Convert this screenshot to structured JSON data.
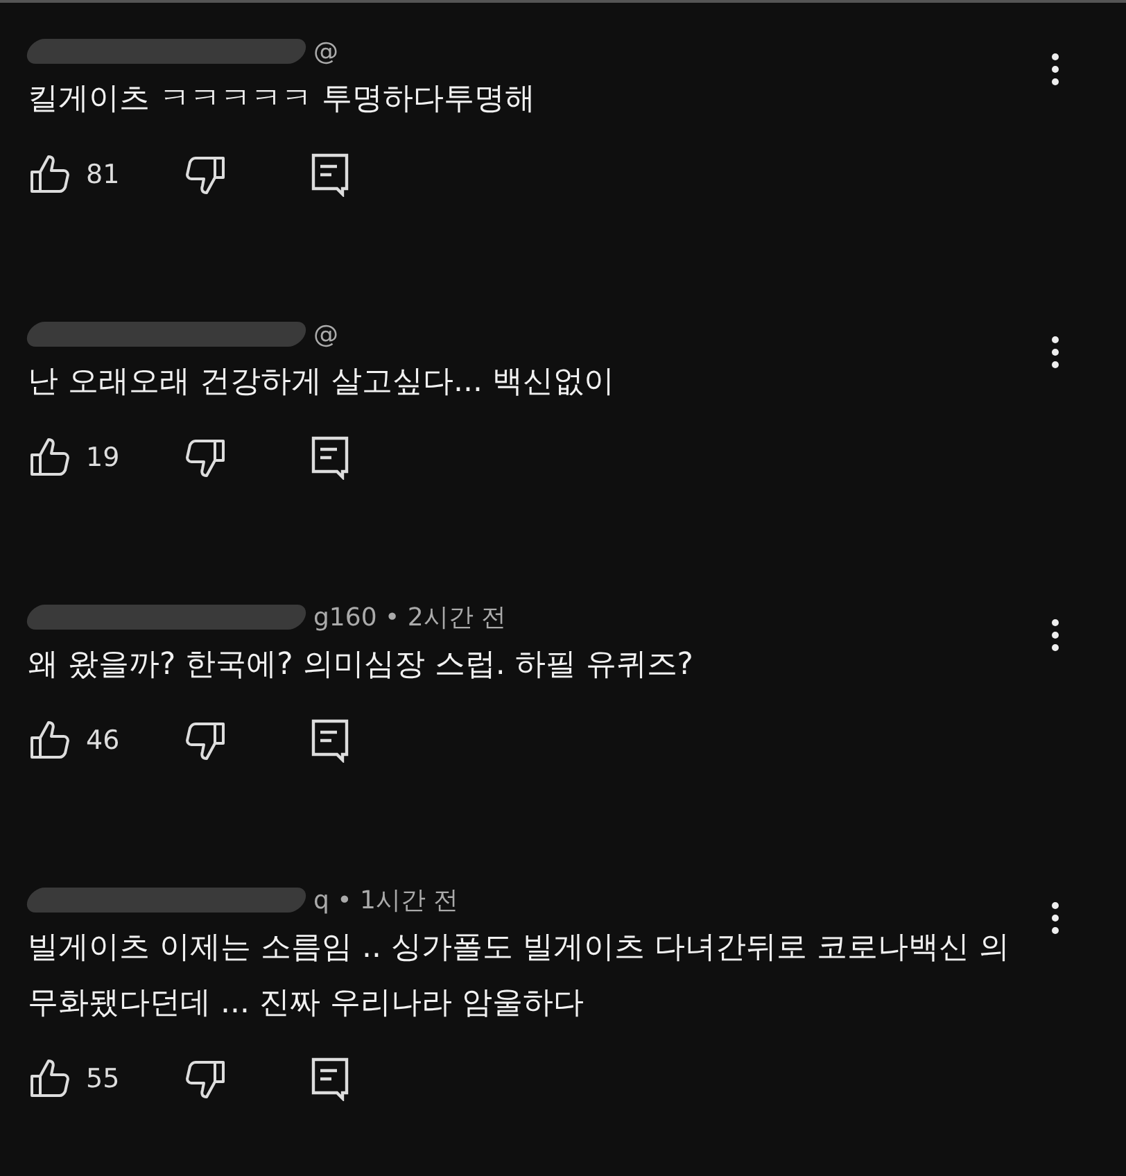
{
  "comments": [
    {
      "author_visible": "@",
      "body": "킬게이츠 ㅋㅋㅋㅋㅋ 투명하다투명해",
      "likes": "81"
    },
    {
      "author_visible": "@",
      "body": "난 오래오래 건강하게 살고싶다...  백신없이",
      "likes": "19"
    },
    {
      "author_visible": "g160 • 2시간 전",
      "body": "왜 왔을까? 한국에? 의미심장 스럽. 하필 유퀴즈?",
      "likes": "46"
    },
    {
      "author_visible": "q • 1시간 전",
      "body": "빌게이츠 이제는 소름임 .. 싱가폴도 빌게이츠 다녀간뒤로 코로나백신 의무화됐다던데 ... 진짜 우리나라 암울하다",
      "likes": "55"
    }
  ]
}
